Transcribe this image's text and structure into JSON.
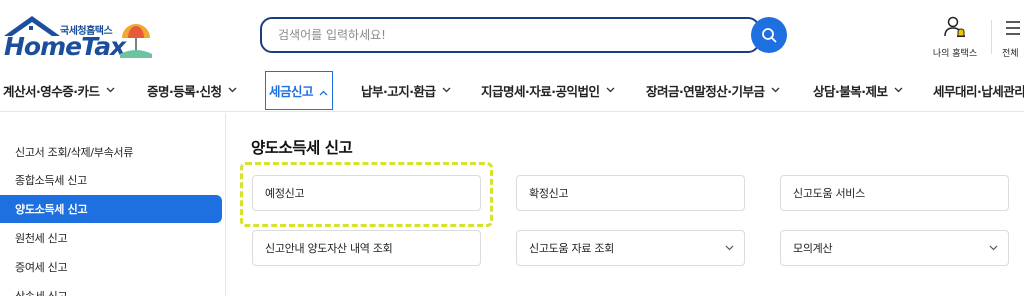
{
  "header": {
    "logo_sub": "국세청홈택스",
    "logo_main": "HomeTax",
    "search_placeholder": "검색어를 입력하세요!",
    "my_hometax_label": "나의 홈택스",
    "all_menu_label": "전체"
  },
  "nav": {
    "items": [
      {
        "label": "계산서·영수증·카드"
      },
      {
        "label": "증명·등록·신청"
      },
      {
        "label": "세금신고",
        "active": true
      },
      {
        "label": "납부·고지·환급"
      },
      {
        "label": "지급명세·자료·공익법인"
      },
      {
        "label": "장려금·연말정산·기부금"
      },
      {
        "label": "상담·불복·제보"
      },
      {
        "label": "세무대리·납세관리"
      }
    ]
  },
  "sidebar": {
    "items": [
      {
        "label": "신고서 조회/삭제/부속서류"
      },
      {
        "label": "종합소득세 신고"
      },
      {
        "label": "양도소득세 신고",
        "active": true
      },
      {
        "label": "원천세 신고"
      },
      {
        "label": "증여세 신고"
      },
      {
        "label": "상속세 신고"
      }
    ]
  },
  "main": {
    "title": "양도소득세 신고",
    "cards": [
      {
        "label": "예정신고",
        "has_dropdown": false
      },
      {
        "label": "확정신고",
        "has_dropdown": false
      },
      {
        "label": "신고도움 서비스",
        "has_dropdown": false
      },
      {
        "label": "신고안내 양도자산 내역 조회",
        "has_dropdown": false
      },
      {
        "label": "신고도움 자료 조회",
        "has_dropdown": true
      },
      {
        "label": "모의계산",
        "has_dropdown": true
      }
    ]
  },
  "colors": {
    "brand_blue": "#1e6fe0",
    "logo_navy": "#1b4f9c",
    "highlight_yellow": "#d7e22a"
  }
}
